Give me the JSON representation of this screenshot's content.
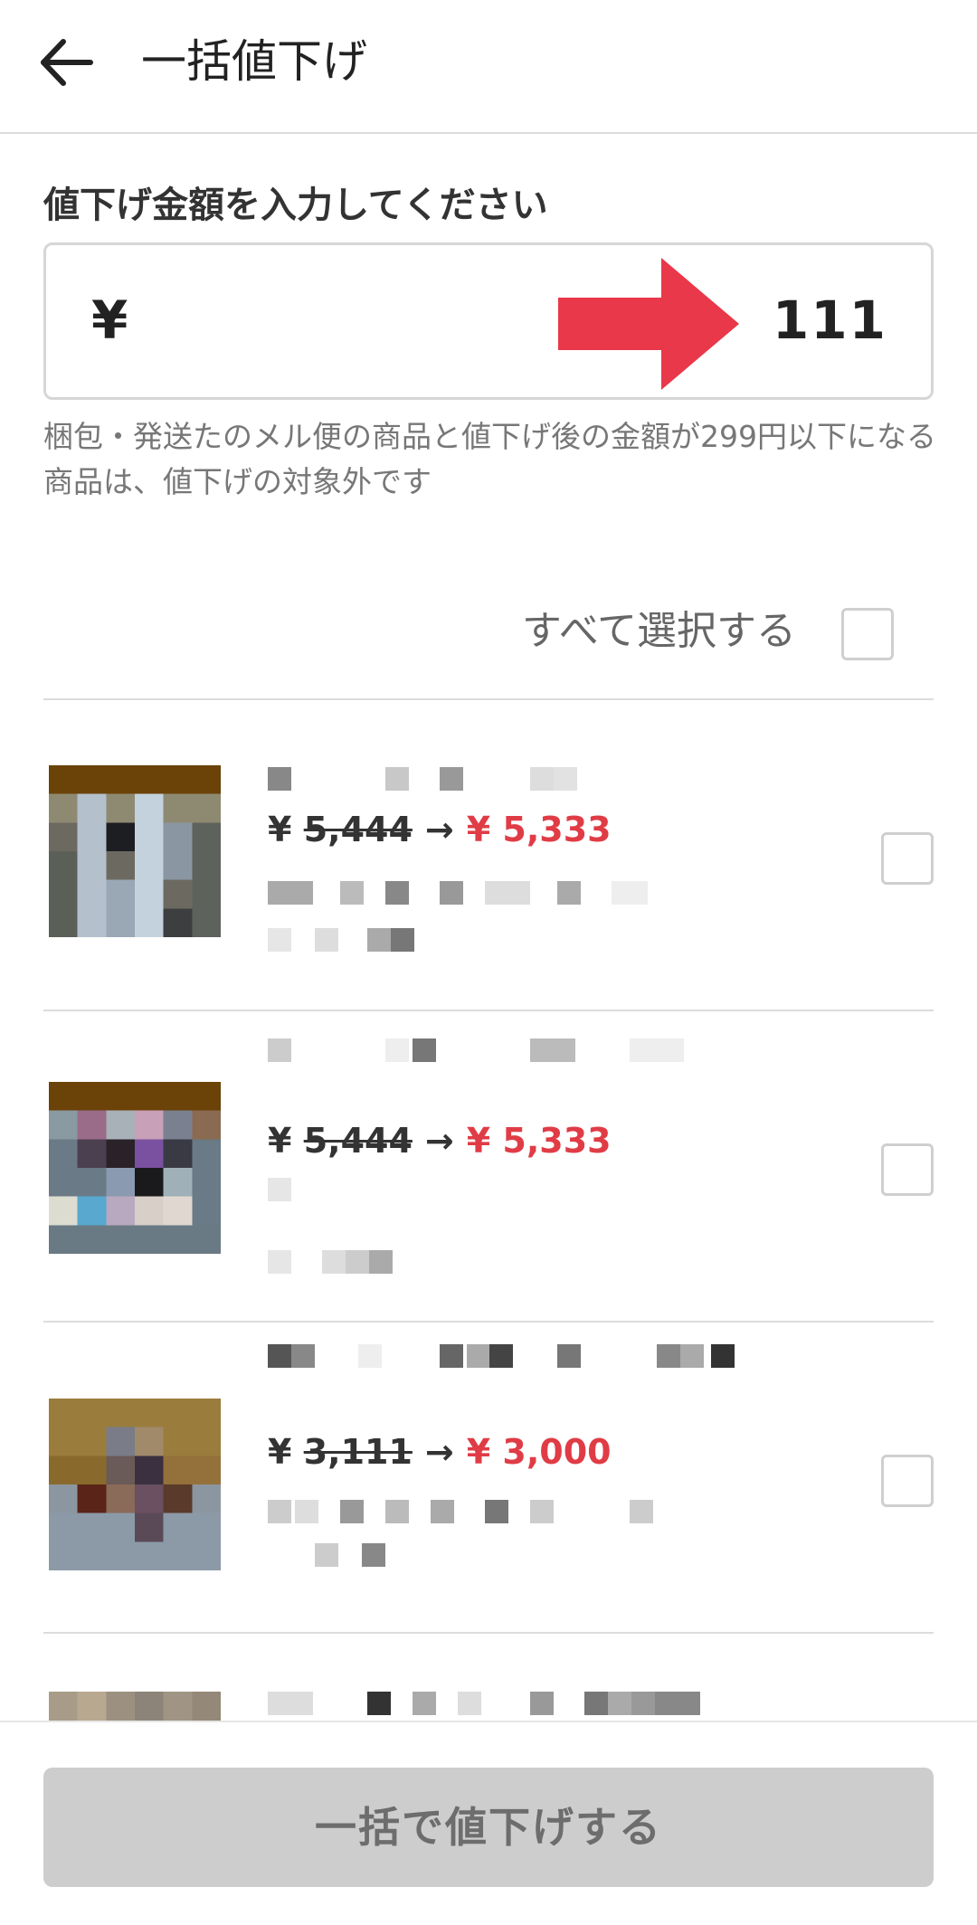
{
  "header": {
    "title": "一括値下げ",
    "back_icon": "arrow-left-icon"
  },
  "amount": {
    "label": "値下げ金額を入力してください",
    "currency": "¥",
    "value": "111"
  },
  "note": "梱包・発送たのメル便の商品と値下げ後の金額が299円以下になる商品は、値下げの対象外です",
  "select_all": {
    "label": "すべて選択する",
    "checked": false
  },
  "items": [
    {
      "currency_old": "¥",
      "old_price": "5,444",
      "arrow": "→",
      "new_price": "¥ 5,333",
      "checked": false
    },
    {
      "currency_old": "¥",
      "old_price": "5,444",
      "arrow": "→",
      "new_price": "¥ 5,333",
      "checked": false
    },
    {
      "currency_old": "¥",
      "old_price": "3,111",
      "arrow": "→",
      "new_price": "¥ 3,000",
      "checked": false
    }
  ],
  "footer": {
    "submit_label": "一括で値下げする"
  },
  "colors": {
    "accent_red": "#e03c46",
    "button_disabled": "#cdcdcd",
    "divider": "#dcdcdc"
  }
}
